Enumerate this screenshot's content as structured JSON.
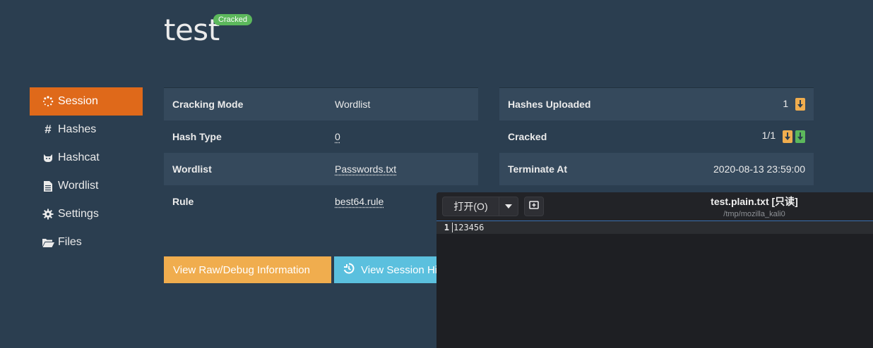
{
  "header": {
    "title": "test",
    "status_badge": "Cracked"
  },
  "sidebar": {
    "items": [
      {
        "label": "Session",
        "icon": "spinner-icon",
        "active": true
      },
      {
        "label": "Hashes",
        "icon": "hash-icon"
      },
      {
        "label": "Hashcat",
        "icon": "cat-icon"
      },
      {
        "label": "Wordlist",
        "icon": "file-icon"
      },
      {
        "label": "Settings",
        "icon": "gear-icon"
      },
      {
        "label": "Files",
        "icon": "folder-open-icon"
      }
    ]
  },
  "left_table": {
    "rows": [
      {
        "key": "Cracking Mode",
        "value": "Wordlist"
      },
      {
        "key": "Hash Type",
        "value": "0"
      },
      {
        "key": "Wordlist",
        "value": "Passwords.txt"
      },
      {
        "key": "Rule",
        "value": "best64.rule"
      }
    ]
  },
  "right_table": {
    "rows": [
      {
        "key": "Hashes Uploaded",
        "value": "1"
      },
      {
        "key": "Cracked",
        "value": "1/1"
      },
      {
        "key": "Terminate At",
        "value": "2020-08-13 23:59:00"
      }
    ]
  },
  "buttons": {
    "raw_debug": "View Raw/Debug Information",
    "session_history": "View Session History"
  },
  "viewer": {
    "open_label": "打开(O)",
    "file_name": "test.plain.txt [只读]",
    "file_path": "/tmp/mozilla_kali0",
    "lines": [
      {
        "number": "1",
        "text": "123456"
      }
    ]
  },
  "colors": {
    "background": "#2b3e50",
    "accent": "#df691a",
    "success": "#5cb85c",
    "warning": "#f0ad4e",
    "info": "#5bc0de"
  }
}
